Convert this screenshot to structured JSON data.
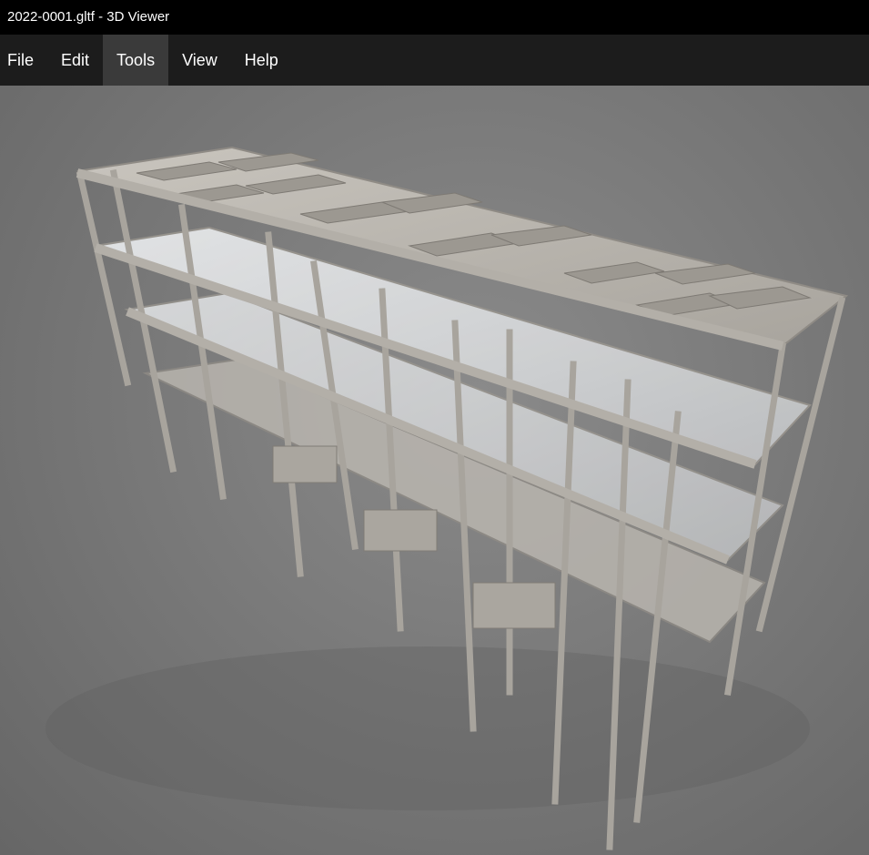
{
  "window": {
    "title": "2022-0001.gltf - 3D Viewer"
  },
  "menu": {
    "items": [
      {
        "label": "File",
        "active": false
      },
      {
        "label": "Edit",
        "active": false
      },
      {
        "label": "Tools",
        "active": true
      },
      {
        "label": "View",
        "active": false
      },
      {
        "label": "Help",
        "active": false
      }
    ]
  },
  "viewport": {
    "background_color": "#7a7a7a",
    "model_color": "#b9b5ae",
    "glass_color": "#e6e8ea"
  }
}
